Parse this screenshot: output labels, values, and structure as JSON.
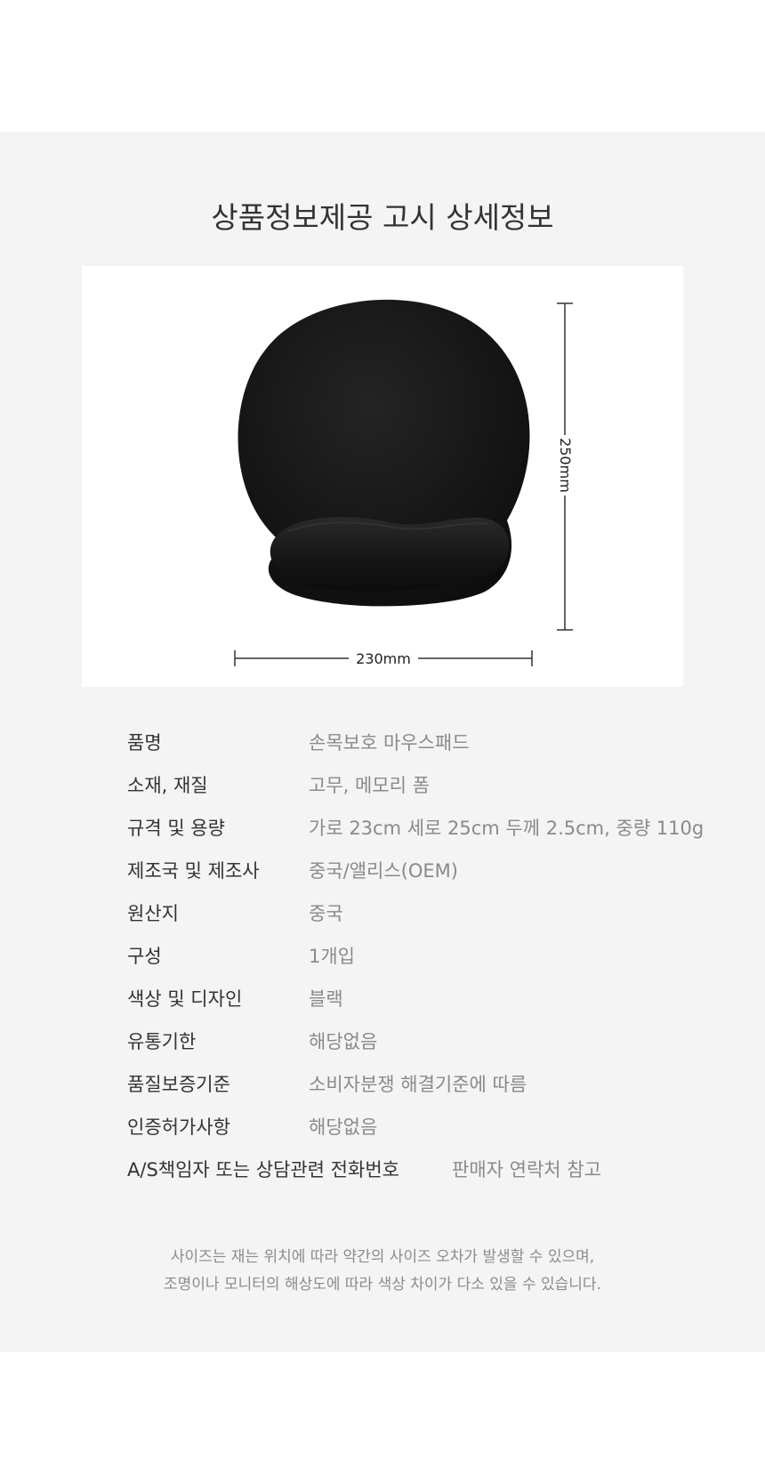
{
  "title": "상품정보제공 고시 상세정보",
  "product_image": {
    "width_label": "230mm",
    "height_label": "250mm",
    "product_color": "#161616"
  },
  "specs": [
    {
      "label": "품명",
      "value": "손목보호 마우스패드"
    },
    {
      "label": "소재, 재질",
      "value": "고무, 메모리 폼"
    },
    {
      "label": "규격 및 용량",
      "value": "가로 23cm 세로 25cm 두께 2.5cm, 중량 110g"
    },
    {
      "label": "제조국 및 제조사",
      "value": "중국/앨리스(OEM)"
    },
    {
      "label": "원산지",
      "value": "중국"
    },
    {
      "label": "구성",
      "value": "1개입"
    },
    {
      "label": "색상 및 디자인",
      "value": "블랙"
    },
    {
      "label": "유통기한",
      "value": "해당없음"
    },
    {
      "label": "품질보증기준",
      "value": "소비자분쟁 해결기준에 따름"
    },
    {
      "label": "인증허가사항",
      "value": "해당없음"
    },
    {
      "label": "A/S책임자 또는 상담관련 전화번호",
      "value": "판매자 연락처 참고"
    }
  ],
  "notice": {
    "line1": "사이즈는 재는 위치에 따라 약간의 사이즈 오차가 발생할 수 있으며,",
    "line2": "조명이나 모니터의 해상도에 따라 색상 차이가 다소 있을 수 있습니다."
  },
  "colors": {
    "panel_background": "#f4f4f4",
    "title_text": "#333333",
    "label_text": "#333333",
    "value_text": "#8a8a8a"
  }
}
